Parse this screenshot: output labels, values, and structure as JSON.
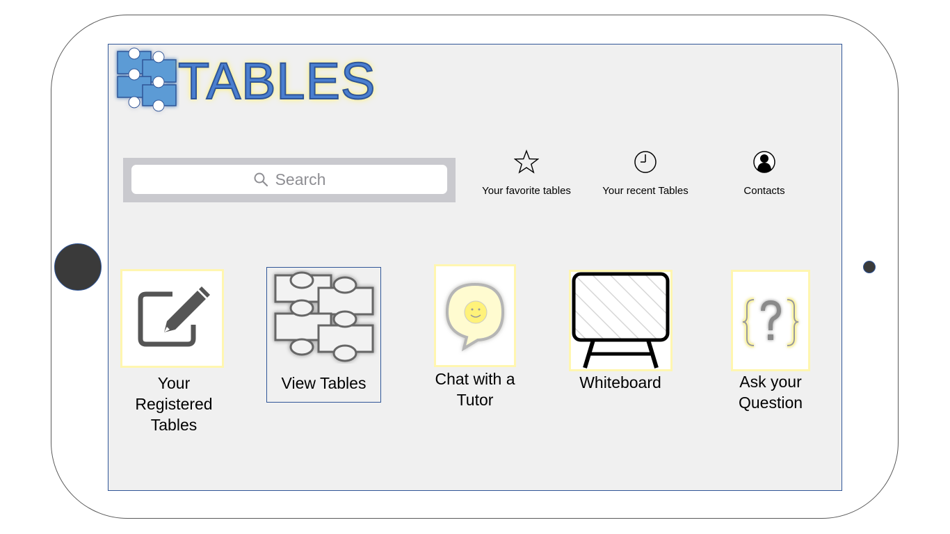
{
  "app": {
    "logo_text": "TABLES"
  },
  "search": {
    "placeholder": "Search"
  },
  "quick_links": [
    {
      "label": "Your favorite tables",
      "icon": "star-icon"
    },
    {
      "label": "Your recent Tables",
      "icon": "clock-icon"
    },
    {
      "label": "Contacts",
      "icon": "contact-icon"
    }
  ],
  "tiles": [
    {
      "label_lines": [
        "Your",
        "Registered",
        "Tables"
      ],
      "icon": "edit-icon"
    },
    {
      "label_lines": [
        "View Tables"
      ],
      "icon": "tables-icon",
      "selected": true
    },
    {
      "label_lines": [
        "Chat with a",
        "Tutor"
      ],
      "icon": "chat-smiley-icon"
    },
    {
      "label_lines": [
        "Whiteboard"
      ],
      "icon": "whiteboard-icon"
    },
    {
      "label_lines": [
        "Ask your",
        "Question"
      ],
      "icon": "question-braces-icon"
    }
  ],
  "colors": {
    "accent_blue": "#2f5597",
    "logo_fill": "#4a7fd0",
    "glow_yellow": "#fff27a",
    "screen_bg": "#f0f0f0"
  }
}
